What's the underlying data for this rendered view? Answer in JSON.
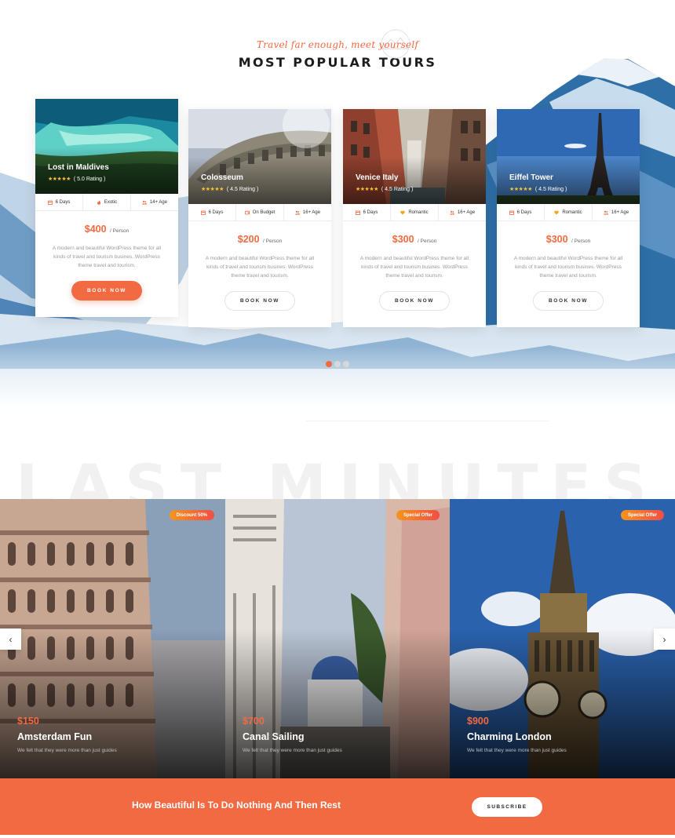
{
  "popular": {
    "tagline": "Travel far enough, meet yourself",
    "title": "MOST POPULAR TOURS",
    "tours": [
      {
        "name": "Lost in Maldives",
        "stars": "★★★★★",
        "rating": "( 5.0 Rating )",
        "meta": [
          "6 Days",
          "Exotic",
          "14+ Age"
        ],
        "price": "$400",
        "per": "/ Person",
        "desc": "A modern and beautiful WordPress theme for all kinds of travel and tourism busines. WordPress theme travel and tourism.",
        "button": "BOOK NOW"
      },
      {
        "name": "Colosseum",
        "stars": "★★★★★",
        "rating": "( 4.5 Rating )",
        "meta": [
          "6 Days",
          "On Budget",
          "16+ Age"
        ],
        "price": "$200",
        "per": "/ Person",
        "desc": "A modern and beautiful WordPress theme for all kinds of travel and tourism busines. WordPress theme travel and tourism.",
        "button": "BOOK NOW"
      },
      {
        "name": "Venice Italy",
        "stars": "★★★★★",
        "rating": "( 4.5 Rating )",
        "meta": [
          "6 Days",
          "Romantic",
          "16+ Age"
        ],
        "price": "$300",
        "per": "/ Person",
        "desc": "A modern and beautiful WordPress theme for all kinds of travel and tourism busines. WordPress theme travel and tourism.",
        "button": "BOOK NOW"
      },
      {
        "name": "Eiffel Tower",
        "stars": "★★★★★",
        "rating": "( 4.5 Rating )",
        "meta": [
          "6 Days",
          "Romantic",
          "16+ Age"
        ],
        "price": "$300",
        "per": "/ Person",
        "desc": "A modern and beautiful WordPress theme for all kinds of travel and tourism busines. WordPress theme travel and tourism.",
        "button": "BOOK NOW"
      }
    ],
    "slider": {
      "pages": 3,
      "active": 1
    }
  },
  "last_minutes": {
    "bg_title": "LAST MINUTES",
    "deals": [
      {
        "badge": "Discount 50%",
        "price": "$150",
        "title": "Amsterdam Fun",
        "desc": "We felt that they were more than just guides"
      },
      {
        "badge": "Special Offer",
        "price": "$700",
        "title": "Canal Sailing",
        "desc": "We felt that they were more than just guides"
      },
      {
        "badge": "Special Offer",
        "price": "$900",
        "title": "Charming London",
        "desc": "We felt that they were more than just guides"
      }
    ],
    "prev_arrow": "‹",
    "next_arrow": "›"
  },
  "subscribe": {
    "text": "How Beautiful Is To Do Nothing And Then Rest",
    "button": "SUBSCRIBE"
  },
  "icons": {
    "days": "calendar-icon",
    "category": [
      "flame-icon",
      "wallet-icon",
      "heart-icon",
      "heart-icon"
    ],
    "age": "people-icon"
  },
  "colors": {
    "accent": "#f26a42",
    "star": "#f8c13a",
    "badge_from": "#f7941d",
    "badge_to": "#f04e45"
  }
}
